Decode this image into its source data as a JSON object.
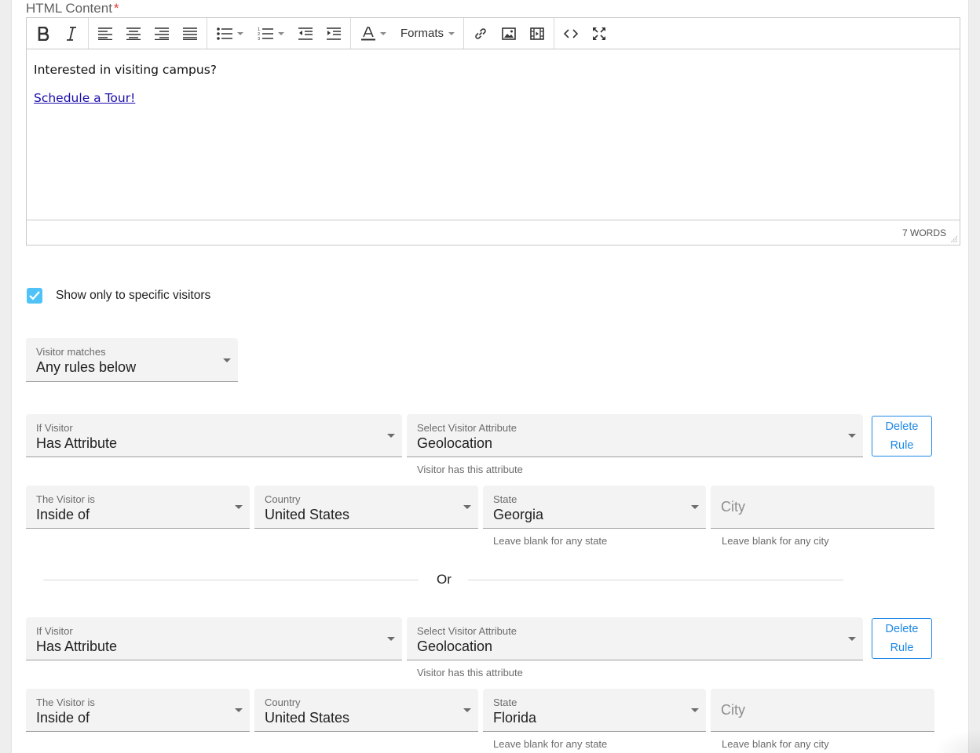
{
  "editor": {
    "field_label": "HTML Content",
    "required_mark": "*",
    "toolbar": {
      "buttons": [
        "bold-icon",
        "italic-icon",
        "align-left-icon",
        "align-center-icon",
        "align-right-icon",
        "align-justify-icon",
        "bullet-list-icon",
        "numbered-list-icon",
        "outdent-icon",
        "indent-icon",
        "text-color-icon",
        "link-icon",
        "image-icon",
        "media-icon",
        "source-code-icon",
        "fullscreen-icon"
      ],
      "formats_label": "Formats"
    },
    "content": {
      "line1": "Interested in visiting campus?",
      "link_text": "Schedule a Tour!"
    },
    "word_count": "7 WORDS"
  },
  "targeting": {
    "checkbox_label": "Show only to specific visitors",
    "checked": true,
    "visitor_matches": {
      "label": "Visitor matches",
      "value": "Any rules below"
    }
  },
  "rules": [
    {
      "if_visitor": {
        "label": "If Visitor",
        "value": "Has Attribute"
      },
      "attribute": {
        "label": "Select Visitor Attribute",
        "value": "Geolocation",
        "helper": "Visitor has this attribute"
      },
      "delete_label_line1": "Delete",
      "delete_label_line2": "Rule",
      "visitor_is": {
        "label": "The Visitor is",
        "value": "Inside of"
      },
      "country": {
        "label": "Country",
        "value": "United States"
      },
      "state": {
        "label": "State",
        "value": "Georgia",
        "helper": "Leave blank for any state"
      },
      "city": {
        "placeholder": "City",
        "helper": "Leave blank for any city"
      }
    },
    {
      "if_visitor": {
        "label": "If Visitor",
        "value": "Has Attribute"
      },
      "attribute": {
        "label": "Select Visitor Attribute",
        "value": "Geolocation",
        "helper": "Visitor has this attribute"
      },
      "delete_label_line1": "Delete",
      "delete_label_line2": "Rule",
      "visitor_is": {
        "label": "The Visitor is",
        "value": "Inside of"
      },
      "country": {
        "label": "Country",
        "value": "United States"
      },
      "state": {
        "label": "State",
        "value": "Florida",
        "helper": "Leave blank for any state"
      },
      "city": {
        "placeholder": "City",
        "helper": "Leave blank for any city"
      }
    }
  ],
  "separator_text": "Or",
  "colors": {
    "accent": "#1e88e5",
    "checkbox": "#4fc3f7",
    "link": "#1a0dab",
    "required": "#e53935"
  }
}
